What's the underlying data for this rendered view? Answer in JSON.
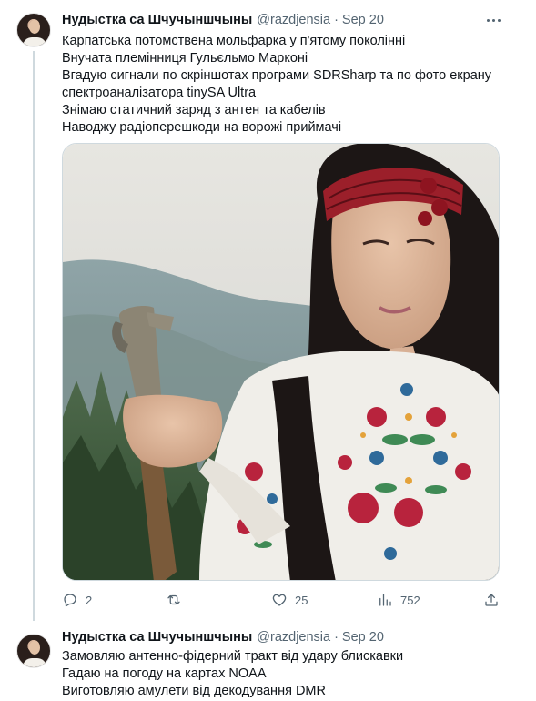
{
  "tweets": [
    {
      "author_name": "Нудыстка са Шчучыншчыны",
      "handle": "@razdjensia",
      "dot": "·",
      "time": "Sep 20",
      "lines": [
        "Карпатська потомствена мольфарка у п'ятому поколінні",
        "Внучата племінниця Гульєльмо Марконі",
        "Вгадую сигнали по скріншотах програми SDRSharp та по фото екрану",
        "спектроаналізатора tinySA Ultra",
        "Знімаю статичний заряд з антен та кабелів",
        "Наводжу радіоперешкоди на ворожі приймачі"
      ],
      "media_icon": "photo-woman-embroidered-blouse-holding-axe-mountains",
      "stats": {
        "replies": "2",
        "reposts": "",
        "likes": "25",
        "views": "752"
      }
    },
    {
      "author_name": "Нудыстка са Шчучыншчыны",
      "handle": "@razdjensia",
      "dot": "·",
      "time": "Sep 20",
      "lines": [
        "Замовляю антенно-фідерний тракт від удару блискавки",
        "Гадаю на погоду на картах NOAA",
        "Виготовляю амулети від декодування DMR"
      ]
    }
  ],
  "icons": {
    "more": "more-horizontal-icon",
    "reply": "reply-icon",
    "repost": "repost-icon",
    "like": "heart-icon",
    "views": "views-icon",
    "share": "share-icon"
  },
  "colors": {
    "text": "#0f1419",
    "secondary": "#536471",
    "border": "#cfd9de"
  }
}
